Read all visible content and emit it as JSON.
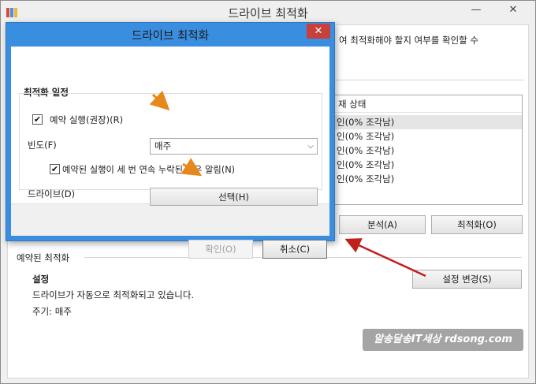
{
  "main_window": {
    "title": "드라이브 최적화",
    "minimize": "—",
    "close": "✕",
    "description": "여 최적화해야 할지 여부를 확인할 수",
    "list_header": "재 상태",
    "list_rows": [
      "인(0% 조각남)",
      "인(0% 조각남)",
      "인(0% 조각남)",
      "인(0% 조각남)",
      "인(0% 조각남)"
    ],
    "analyze_button": "분석(A)",
    "optimize_button": "최적화(O)",
    "scheduled_section": "예약된 최적화",
    "settings_label": "설정",
    "status_text": "드라이브가 자동으로 최적화되고 있습니다.",
    "frequency_text": "주기: 매주",
    "change_settings_button": "설정 변경(S)",
    "watermark": "알송달송IT세상 rdsong.com"
  },
  "dialog": {
    "title": "드라이브 최적화",
    "close": "✕",
    "section_title": "최적화 일정",
    "run_on_schedule_label": "예약 실행(권장)(R)",
    "run_on_schedule_checked": true,
    "frequency_label": "빈도(F)",
    "frequency_value": "매주",
    "notify_label": "예약된 실행이 세 번 연속 누락된 경우 알림(N)",
    "notify_checked": true,
    "drives_label": "드라이브(D)",
    "choose_button": "선택(H)",
    "ok_button": "확인(O)",
    "cancel_button": "취소(C)"
  },
  "colors": {
    "dialog_frame": "#3a8ee0",
    "close_button": "#c7403a",
    "annotation_orange": "#e8871a",
    "annotation_red": "#c0201c"
  }
}
